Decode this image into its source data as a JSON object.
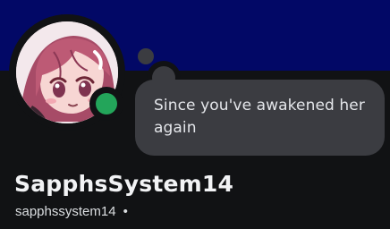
{
  "profile": {
    "display_name": "SapphsSystem14",
    "username": "sapphssystem14",
    "separator": "•",
    "status": "online",
    "status_color": "#23a55a",
    "banner_color": "#020866"
  },
  "custom_status": {
    "text": "Since you've awakened her again"
  }
}
